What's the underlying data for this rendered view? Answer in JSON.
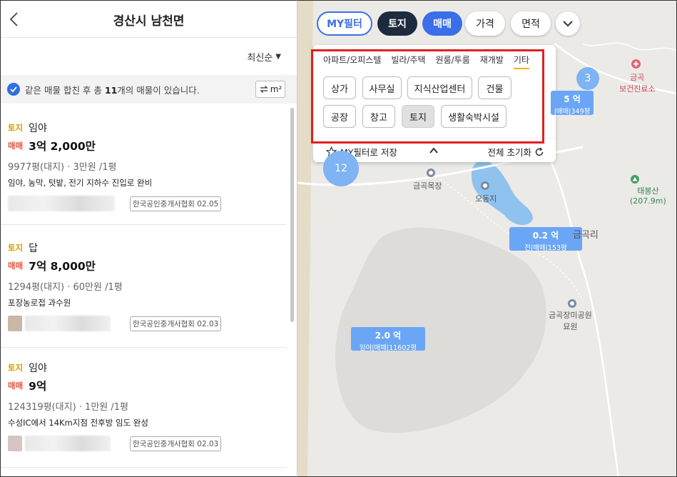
{
  "header": {
    "title": "경산시 남천면"
  },
  "sort": {
    "label": "최신순"
  },
  "notice": {
    "prefix": "같은 매물 합친 후 총 ",
    "count": "11",
    "suffix": "개의 매물이 있습니다.",
    "unit_label": "m²"
  },
  "listings": [
    {
      "type_badge": "토지",
      "type_name": "임야",
      "deal": "매매",
      "price": "3억 2,000만",
      "area": "9977평(대지) · 3만원 /1평",
      "desc": "임야, 농막, 텃밭, 전기 지하수 진입로 완비",
      "association": "한국공인중개사협회 02.05"
    },
    {
      "type_badge": "토지",
      "type_name": "답",
      "deal": "매매",
      "price": "7억 8,000만",
      "area": "1294평(대지) · 60만원 /1평",
      "desc": "포장농로접 과수원",
      "association": "한국공인중개사협회 02.03"
    },
    {
      "type_badge": "토지",
      "type_name": "임야",
      "deal": "매매",
      "price": "9억",
      "area": "124319평(대지) · 1만원 /1평",
      "desc": "수성IC에서 14Km지점 전후방 임도 완성",
      "association": "한국공인중개사협회 02.03"
    }
  ],
  "map": {
    "chips": {
      "my_filter": "MY필터",
      "land": "토지",
      "sale": "매매",
      "price": "가격",
      "area": "면적"
    },
    "filter_tabs": [
      "아파트/오피스텔",
      "빌라/주택",
      "원룸/투룸",
      "재개발",
      "기타"
    ],
    "property_types": [
      "상가",
      "사무실",
      "지식산업센터",
      "건물",
      "공장",
      "창고",
      "토지",
      "생활숙박시설"
    ],
    "save_label": "MY필터로 저장",
    "reset_label": "전체 초기화",
    "markers": [
      {
        "price": "0.2 억",
        "sub": "전|매매|153평"
      },
      {
        "price": "2.0 억",
        "sub": "임야|매매|11602평"
      },
      {
        "price": "5 억",
        "sub": "|매매|349평"
      }
    ],
    "clusters": [
      "12",
      "3"
    ],
    "labels": {
      "geumgok_ranch": "금곡목장",
      "odong_pond": "오동지",
      "geumgok_ri": "금곡리",
      "cemetery": "금곡장미공원\n묘원",
      "taebongsan": "태봉산\n(207.9m)",
      "clinic": "금곡\n보건진료소"
    }
  }
}
